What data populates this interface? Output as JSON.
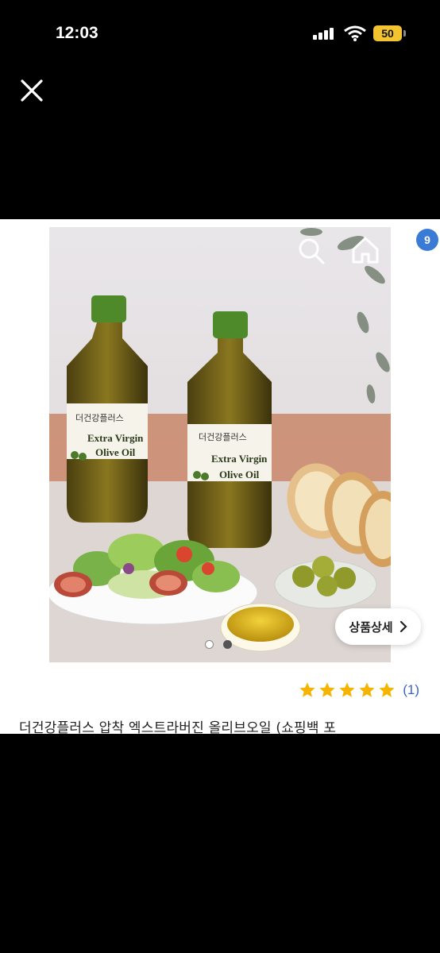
{
  "status_bar": {
    "time": "12:03",
    "battery": "50"
  },
  "product": {
    "image": {
      "bottle_label_line1": "Extra Virgin",
      "bottle_label_line2": "Olive Oil",
      "brand_script": "더건강플러스"
    },
    "detail_button_label": "상품상세",
    "cart_count": "9",
    "rating_stars": 5,
    "rating_count": "(1)",
    "title": "더건강플러스 압착 엑스트라버진 올리브오일 (쇼핑백 포",
    "current_image_index": 2,
    "total_images": 2
  },
  "colors": {
    "accent_blue": "#3a7bd5",
    "star": "#f5b400",
    "rating_link": "#3a63c7"
  },
  "icons": [
    "close-icon",
    "back-icon",
    "search-icon",
    "home-icon",
    "cart-icon",
    "star-icon",
    "chevron-right-icon"
  ]
}
